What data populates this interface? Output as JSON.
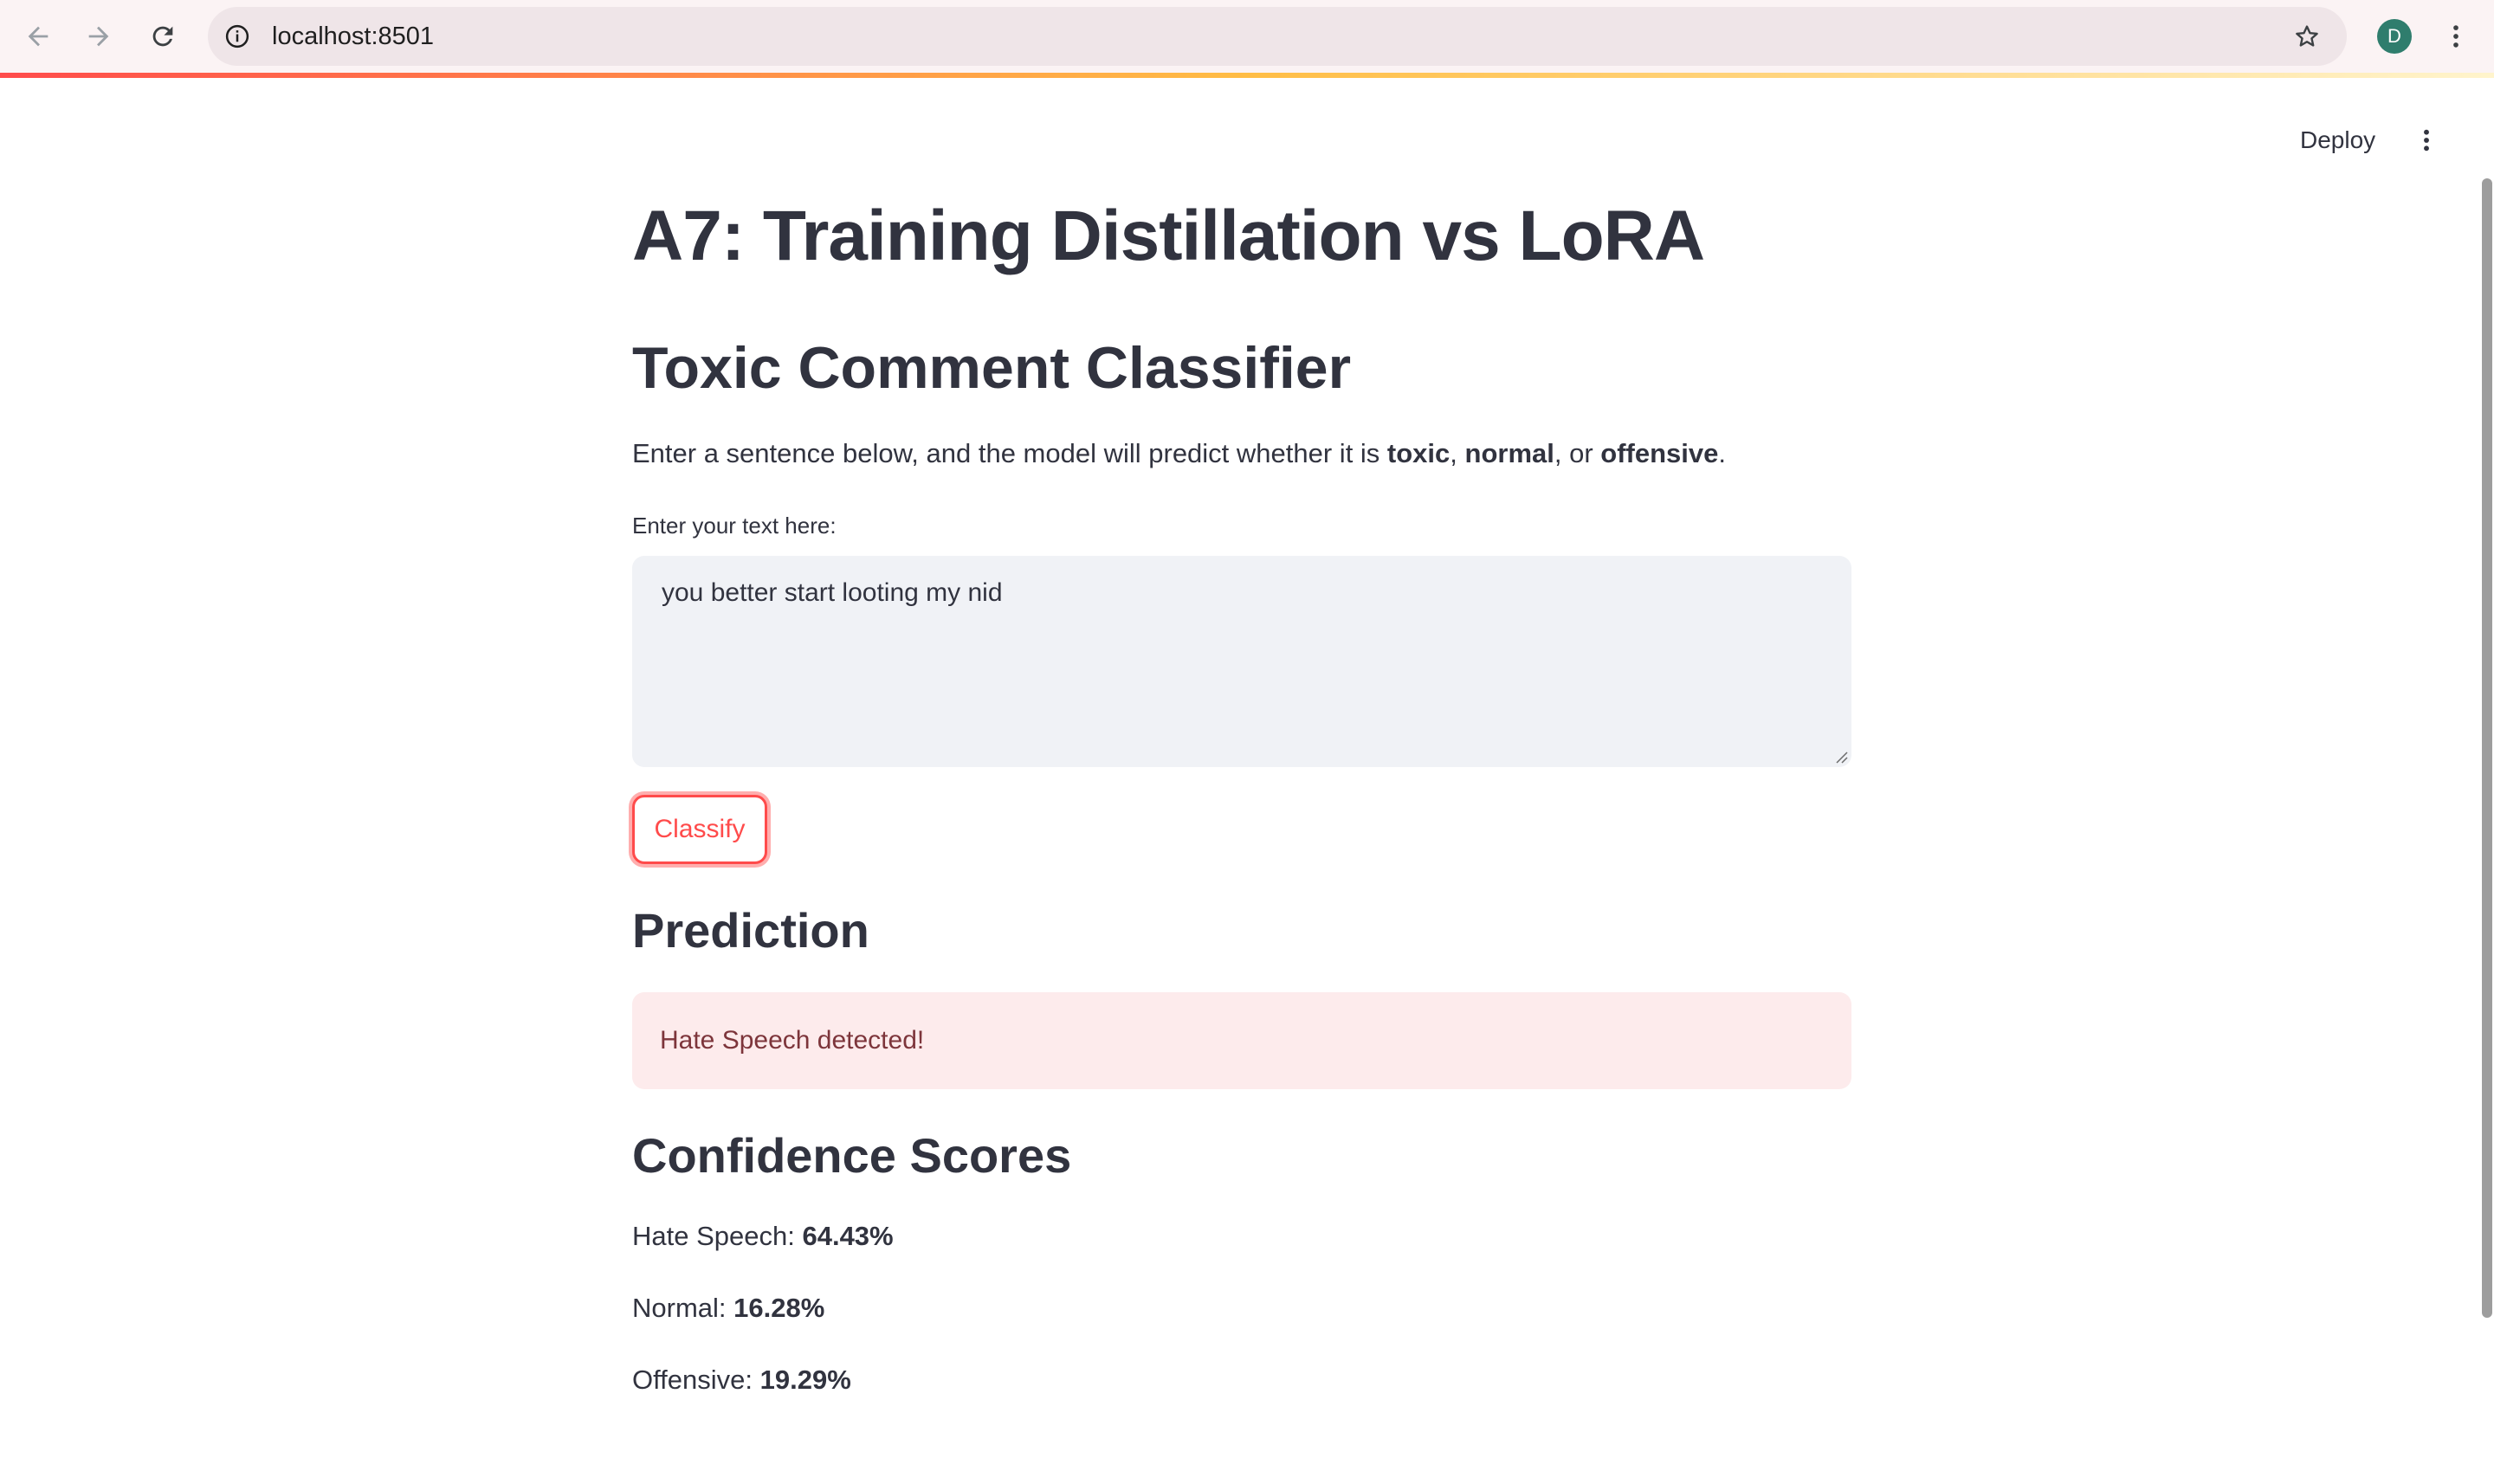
{
  "browser": {
    "url": "localhost:8501",
    "profile_initial": "D",
    "profile_color": "#2f7d6d"
  },
  "toolbar": {
    "deploy_label": "Deploy"
  },
  "main": {
    "title": "A7: Training Distillation vs LoRA",
    "subtitle": "Toxic Comment Classifier",
    "description": {
      "prefix": "Enter a sentence below, and the model will predict whether it is ",
      "option1": "toxic",
      "sep1": ", ",
      "option2": "normal",
      "sep2": ", or ",
      "option3": "offensive",
      "suffix": "."
    },
    "input": {
      "label": "Enter your text here:",
      "value": "you better start looting my nid"
    },
    "classify_label": "Classify",
    "prediction": {
      "heading": "Prediction",
      "message": "Hate Speech detected!"
    },
    "confidence": {
      "heading": "Confidence Scores",
      "scores": [
        {
          "label": "Hate Speech: ",
          "value": "64.43%"
        },
        {
          "label": "Normal: ",
          "value": "16.28%"
        },
        {
          "label": "Offensive: ",
          "value": "19.29%"
        }
      ]
    }
  },
  "colors": {
    "accent": "#ff4b4b",
    "error_bg": "#fdebec",
    "error_text": "#7d353b",
    "text": "#31333f",
    "input_bg": "#f0f2f6"
  }
}
